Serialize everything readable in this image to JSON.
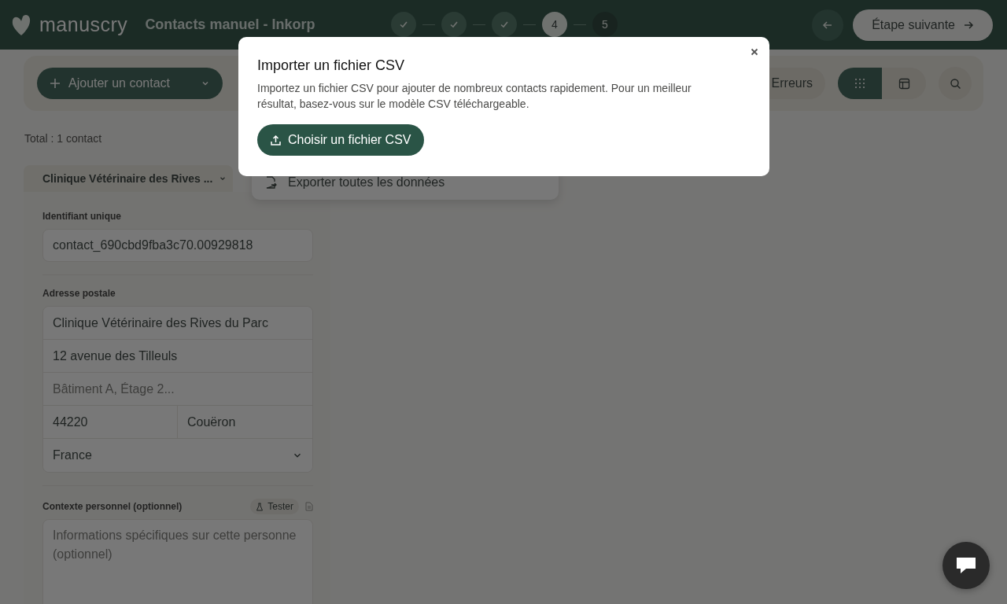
{
  "header": {
    "logo_text": "manuscry",
    "title": "Contacts manuel - Inkorp",
    "steps": [
      {
        "done": true,
        "current": false
      },
      {
        "done": true,
        "current": false
      },
      {
        "done": true,
        "current": false
      },
      {
        "done": false,
        "current": true,
        "label": "4"
      },
      {
        "done": false,
        "current": false,
        "label": "5"
      }
    ],
    "next_button": "Étape suivante"
  },
  "toolbar": {
    "add_button": "Ajouter un contact",
    "errors_button": "Erreurs",
    "views": [
      {
        "kind": "grid",
        "selected": true
      },
      {
        "kind": "table",
        "selected": false
      }
    ]
  },
  "total": "Total : 1 contact",
  "export_item": "Exporter toutes les données",
  "contact": {
    "tab": "Clinique Vétérinaire des Rives ...",
    "id_label": "Identifiant unique",
    "id_value": "contact_690cbd9fba3c70.00929818",
    "address_label": "Adresse postale",
    "address_name": "Clinique Vétérinaire des Rives du Parc",
    "address_street": "12 avenue des Tilleuls",
    "address_extra_placeholder": "Bâtiment A, Étage 2...",
    "postal_code": "44220",
    "city": "Couëron",
    "country": "France",
    "context_label": "Contexte personnel (optionnel)",
    "tester_button": "Tester",
    "context_placeholder": "Informations spécifiques sur cette personne (optionnel)"
  },
  "modal": {
    "title": "Importer un fichier CSV",
    "description": "Importez un fichier CSV pour ajouter de nombreux contacts rapidement. Pour un meilleur résultat, basez-vous sur le modèle CSV téléchargeable.",
    "button": "Choisir un fichier CSV"
  }
}
